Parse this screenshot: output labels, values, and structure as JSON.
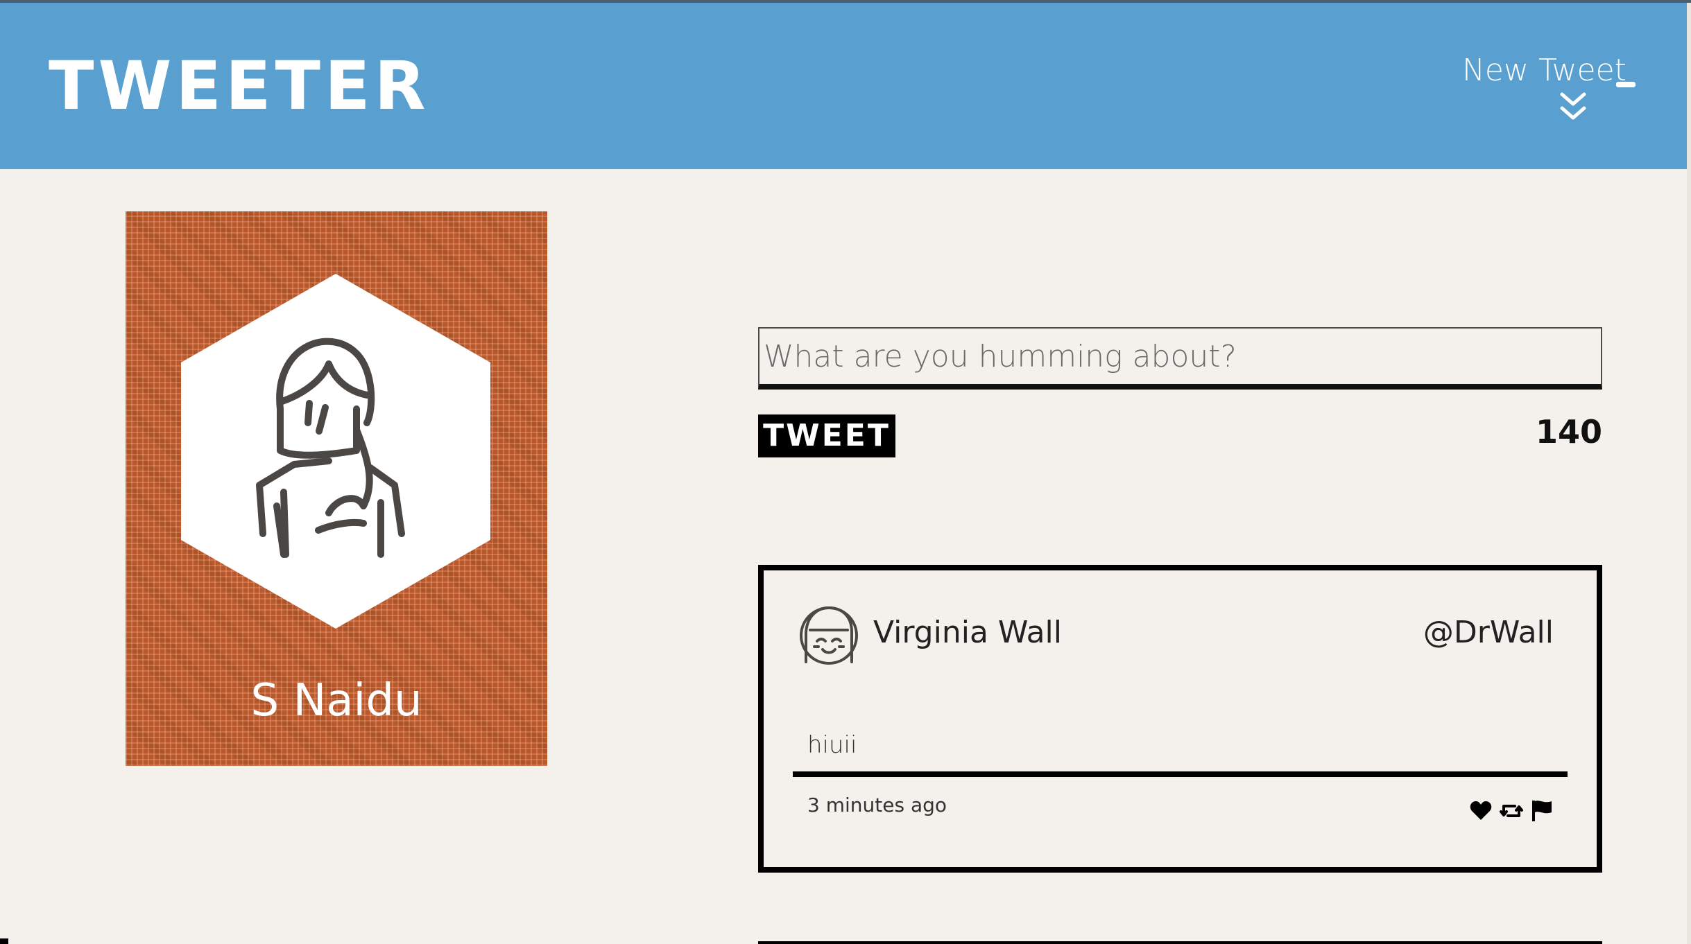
{
  "header": {
    "brand": "TWEETER",
    "compose_toggle_label": "New Tweet"
  },
  "profile": {
    "name": "S Naidu",
    "card_color": "#b8582c"
  },
  "compose": {
    "placeholder": "What are you humming about?",
    "submit_label": "TWEET",
    "char_count": "140"
  },
  "tweets": [
    {
      "author_name": "Virginia Wall",
      "handle": "@DrWall",
      "text": "hiuii",
      "timestamp": "3 minutes ago",
      "actions": [
        "heart-icon",
        "retweet-icon",
        "flag-icon"
      ]
    }
  ],
  "colors": {
    "navbar": "#59a0d0",
    "page_background": "#f4f1ec",
    "accent_black": "#000000"
  }
}
